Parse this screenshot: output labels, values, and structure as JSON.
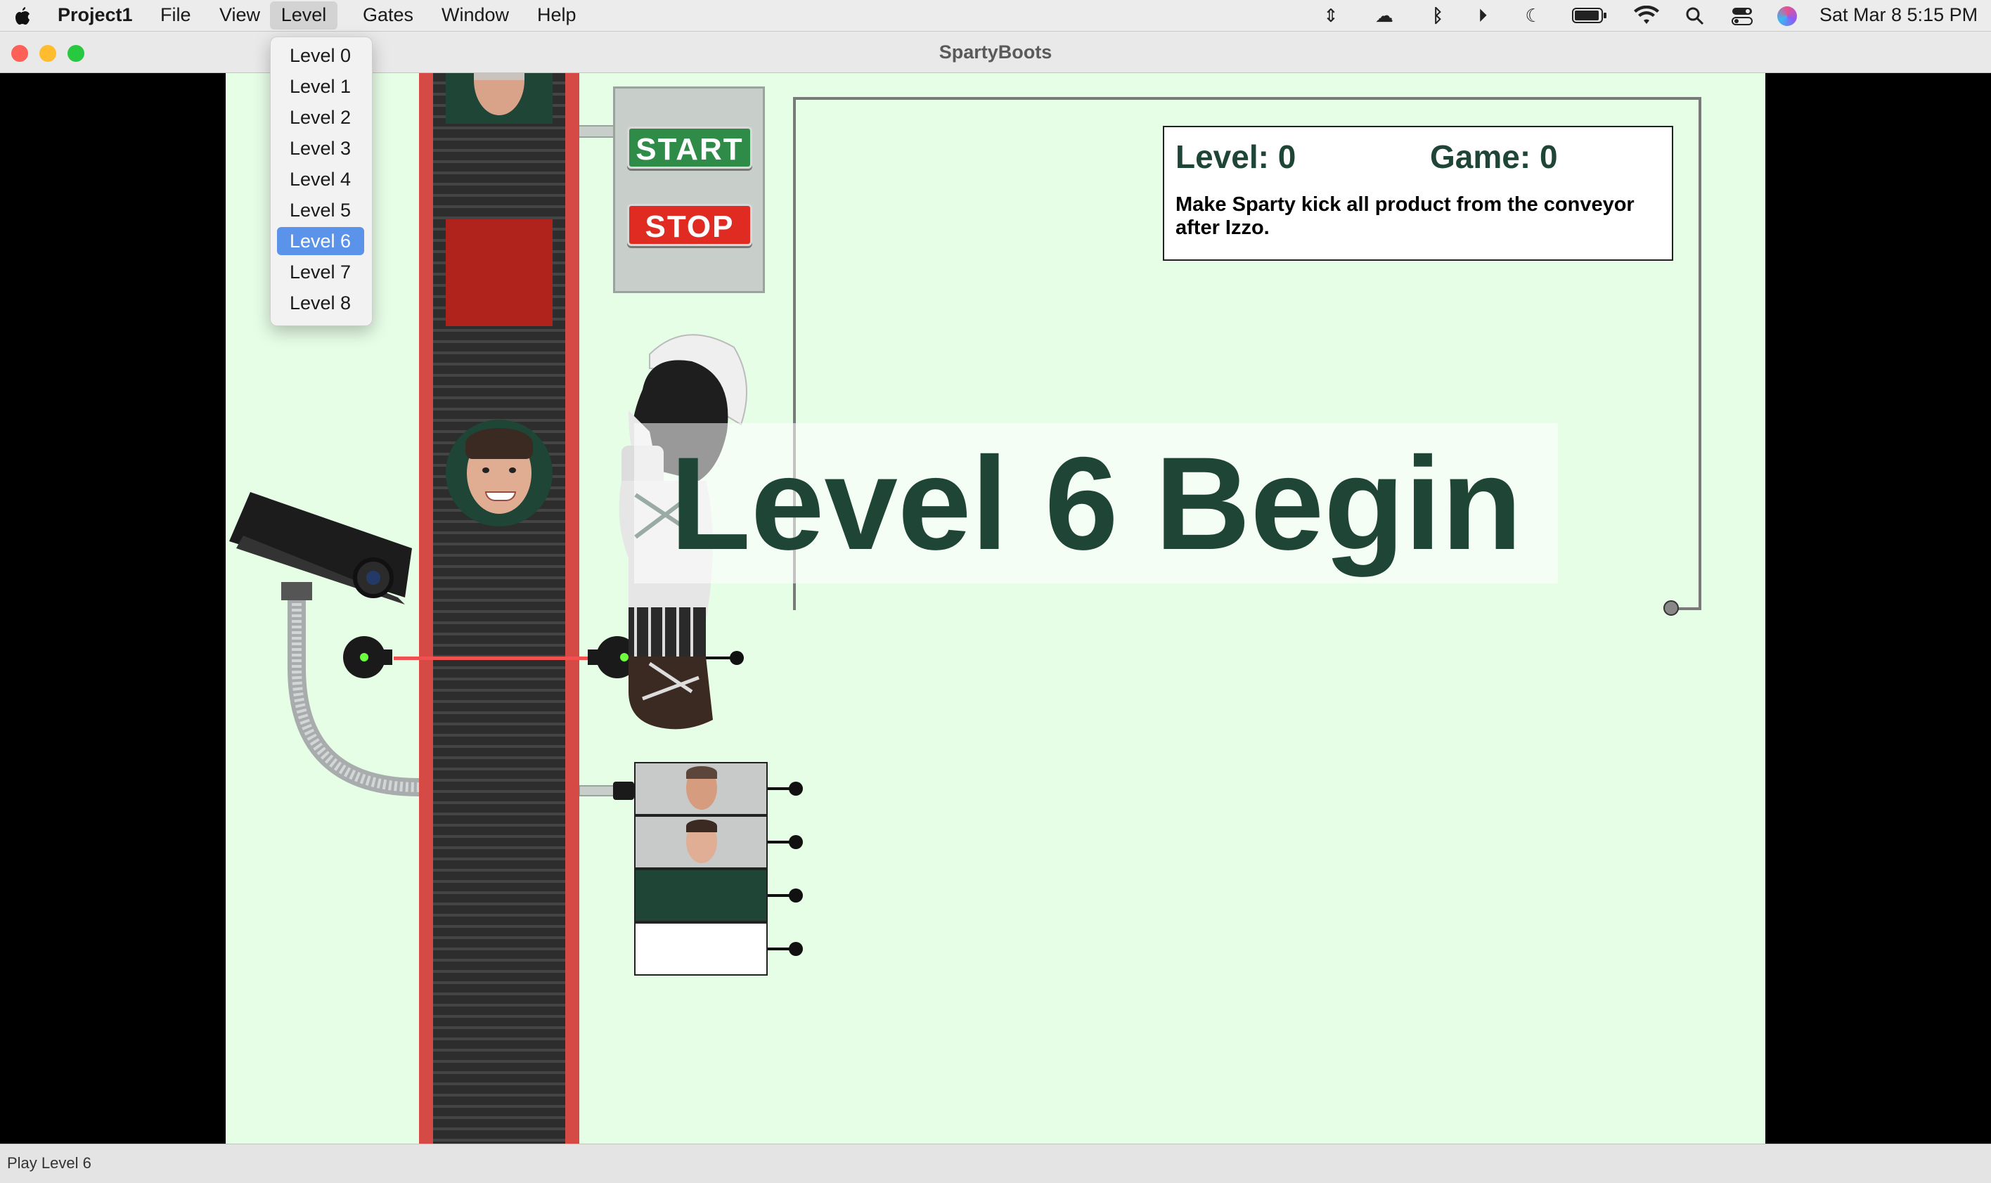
{
  "menubar": {
    "app_name": "Project1",
    "items": [
      "File",
      "View",
      "Level",
      "Gates",
      "Window",
      "Help"
    ],
    "clock": "Sat Mar 8  5:15 PM"
  },
  "window": {
    "title": "SpartyBoots"
  },
  "level_menu": {
    "items": [
      "Level 0",
      "Level 1",
      "Level 2",
      "Level 3",
      "Level 4",
      "Level 5",
      "Level 6",
      "Level 7",
      "Level 8"
    ],
    "selected": "Level 6"
  },
  "controls": {
    "start_label": "START",
    "stop_label": "STOP"
  },
  "scoreboard": {
    "level_text": "Level: 0",
    "game_text": "Game: 0",
    "instructions": "Make Sparty kick all product from the conveyor after Izzo."
  },
  "banner": {
    "text": "Level 6 Begin"
  },
  "statusbar": {
    "text": "Play Level 6"
  },
  "colors": {
    "playfield_bg": "#e6fde6",
    "msu_green": "#1e4536",
    "conveyor_red": "#d64a45",
    "product_red": "#b0231c",
    "start_green": "#2e8b48",
    "stop_red": "#e02b22",
    "menu_highlight": "#5c93ea"
  }
}
